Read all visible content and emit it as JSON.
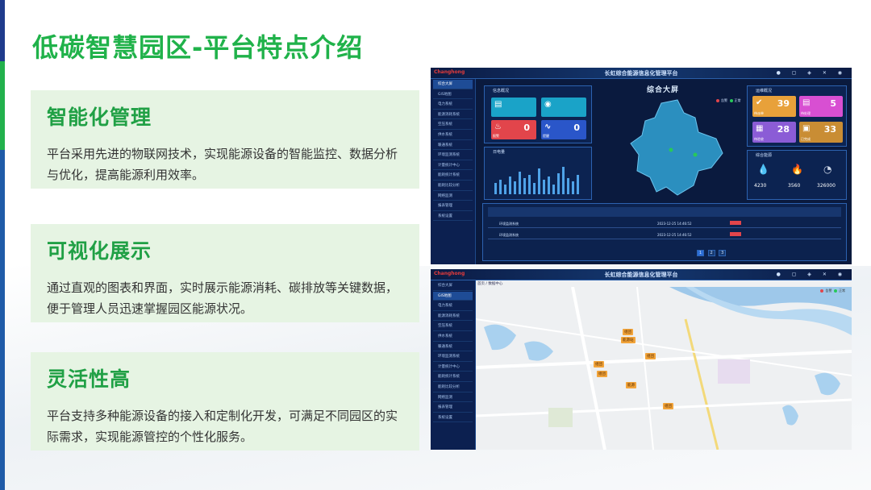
{
  "page": {
    "title": "低碳智慧园区-平台特点介绍"
  },
  "features": [
    {
      "heading": "智能化管理",
      "text": "平台采用先进的物联网技术，实现能源设备的智能监控、数据分析与优化，提高能源利用效率。"
    },
    {
      "heading": "可视化展示",
      "text": "通过直观的图表和界面，实时展示能源消耗、碳排放等关键数据，便于管理人员迅速掌握园区能源状况。"
    },
    {
      "heading": "灵活性高",
      "text": "平台支持多种能源设备的接入和定制化开发，可满足不同园区的实际需求，实现能源管控的个性化服务。"
    }
  ],
  "dashboard": {
    "brand": "Changhong",
    "system_title": "长虹综合能源信息化管理平台",
    "big_screen_title": "综合大屏",
    "sidebar": [
      "综合大屏",
      "GIS地图",
      "电力系统",
      "能源消耗系统",
      "空压系统",
      "供水系统",
      "暖通系统",
      "环境监测系统",
      "计量统计中心",
      "能耗统计系统",
      "能耗比较分析",
      "网络监测",
      "报表管理",
      "系统设置"
    ],
    "panels": {
      "info": "信息概况",
      "daily": "日电量",
      "ops": "运维概况",
      "energy": "综合能源"
    },
    "info_tiles": [
      {
        "num": "0",
        "label": "报警"
      },
      {
        "num": "0",
        "label": "提醒"
      }
    ],
    "ops_tiles": [
      {
        "num": "39",
        "label": "待派单"
      },
      {
        "num": "5",
        "label": "待处理"
      },
      {
        "num": "28",
        "label": "待验收"
      },
      {
        "num": "33",
        "label": "已完成"
      }
    ],
    "energy_values": [
      "4230",
      "3560",
      "326000"
    ],
    "legend": [
      "告警",
      "正常"
    ],
    "rows": [
      [
        "环境监测系统",
        "2023-12-25 14:46:52"
      ],
      [
        "环境监测系统",
        "2023-12-25 14:46:52"
      ]
    ],
    "pages": [
      "1",
      "2",
      "3"
    ],
    "colors": {
      "accent": "#20b24a",
      "card": "#e6f4e3",
      "dash_bg": "#0a1a3e"
    }
  },
  "map": {
    "system_title": "长虹综合能源信息化管理平台",
    "breadcrumb": "首页 / 数据中心",
    "pins": [
      "组团",
      "能源站",
      "组团",
      "组团",
      "组团",
      "能源",
      "组团"
    ]
  }
}
